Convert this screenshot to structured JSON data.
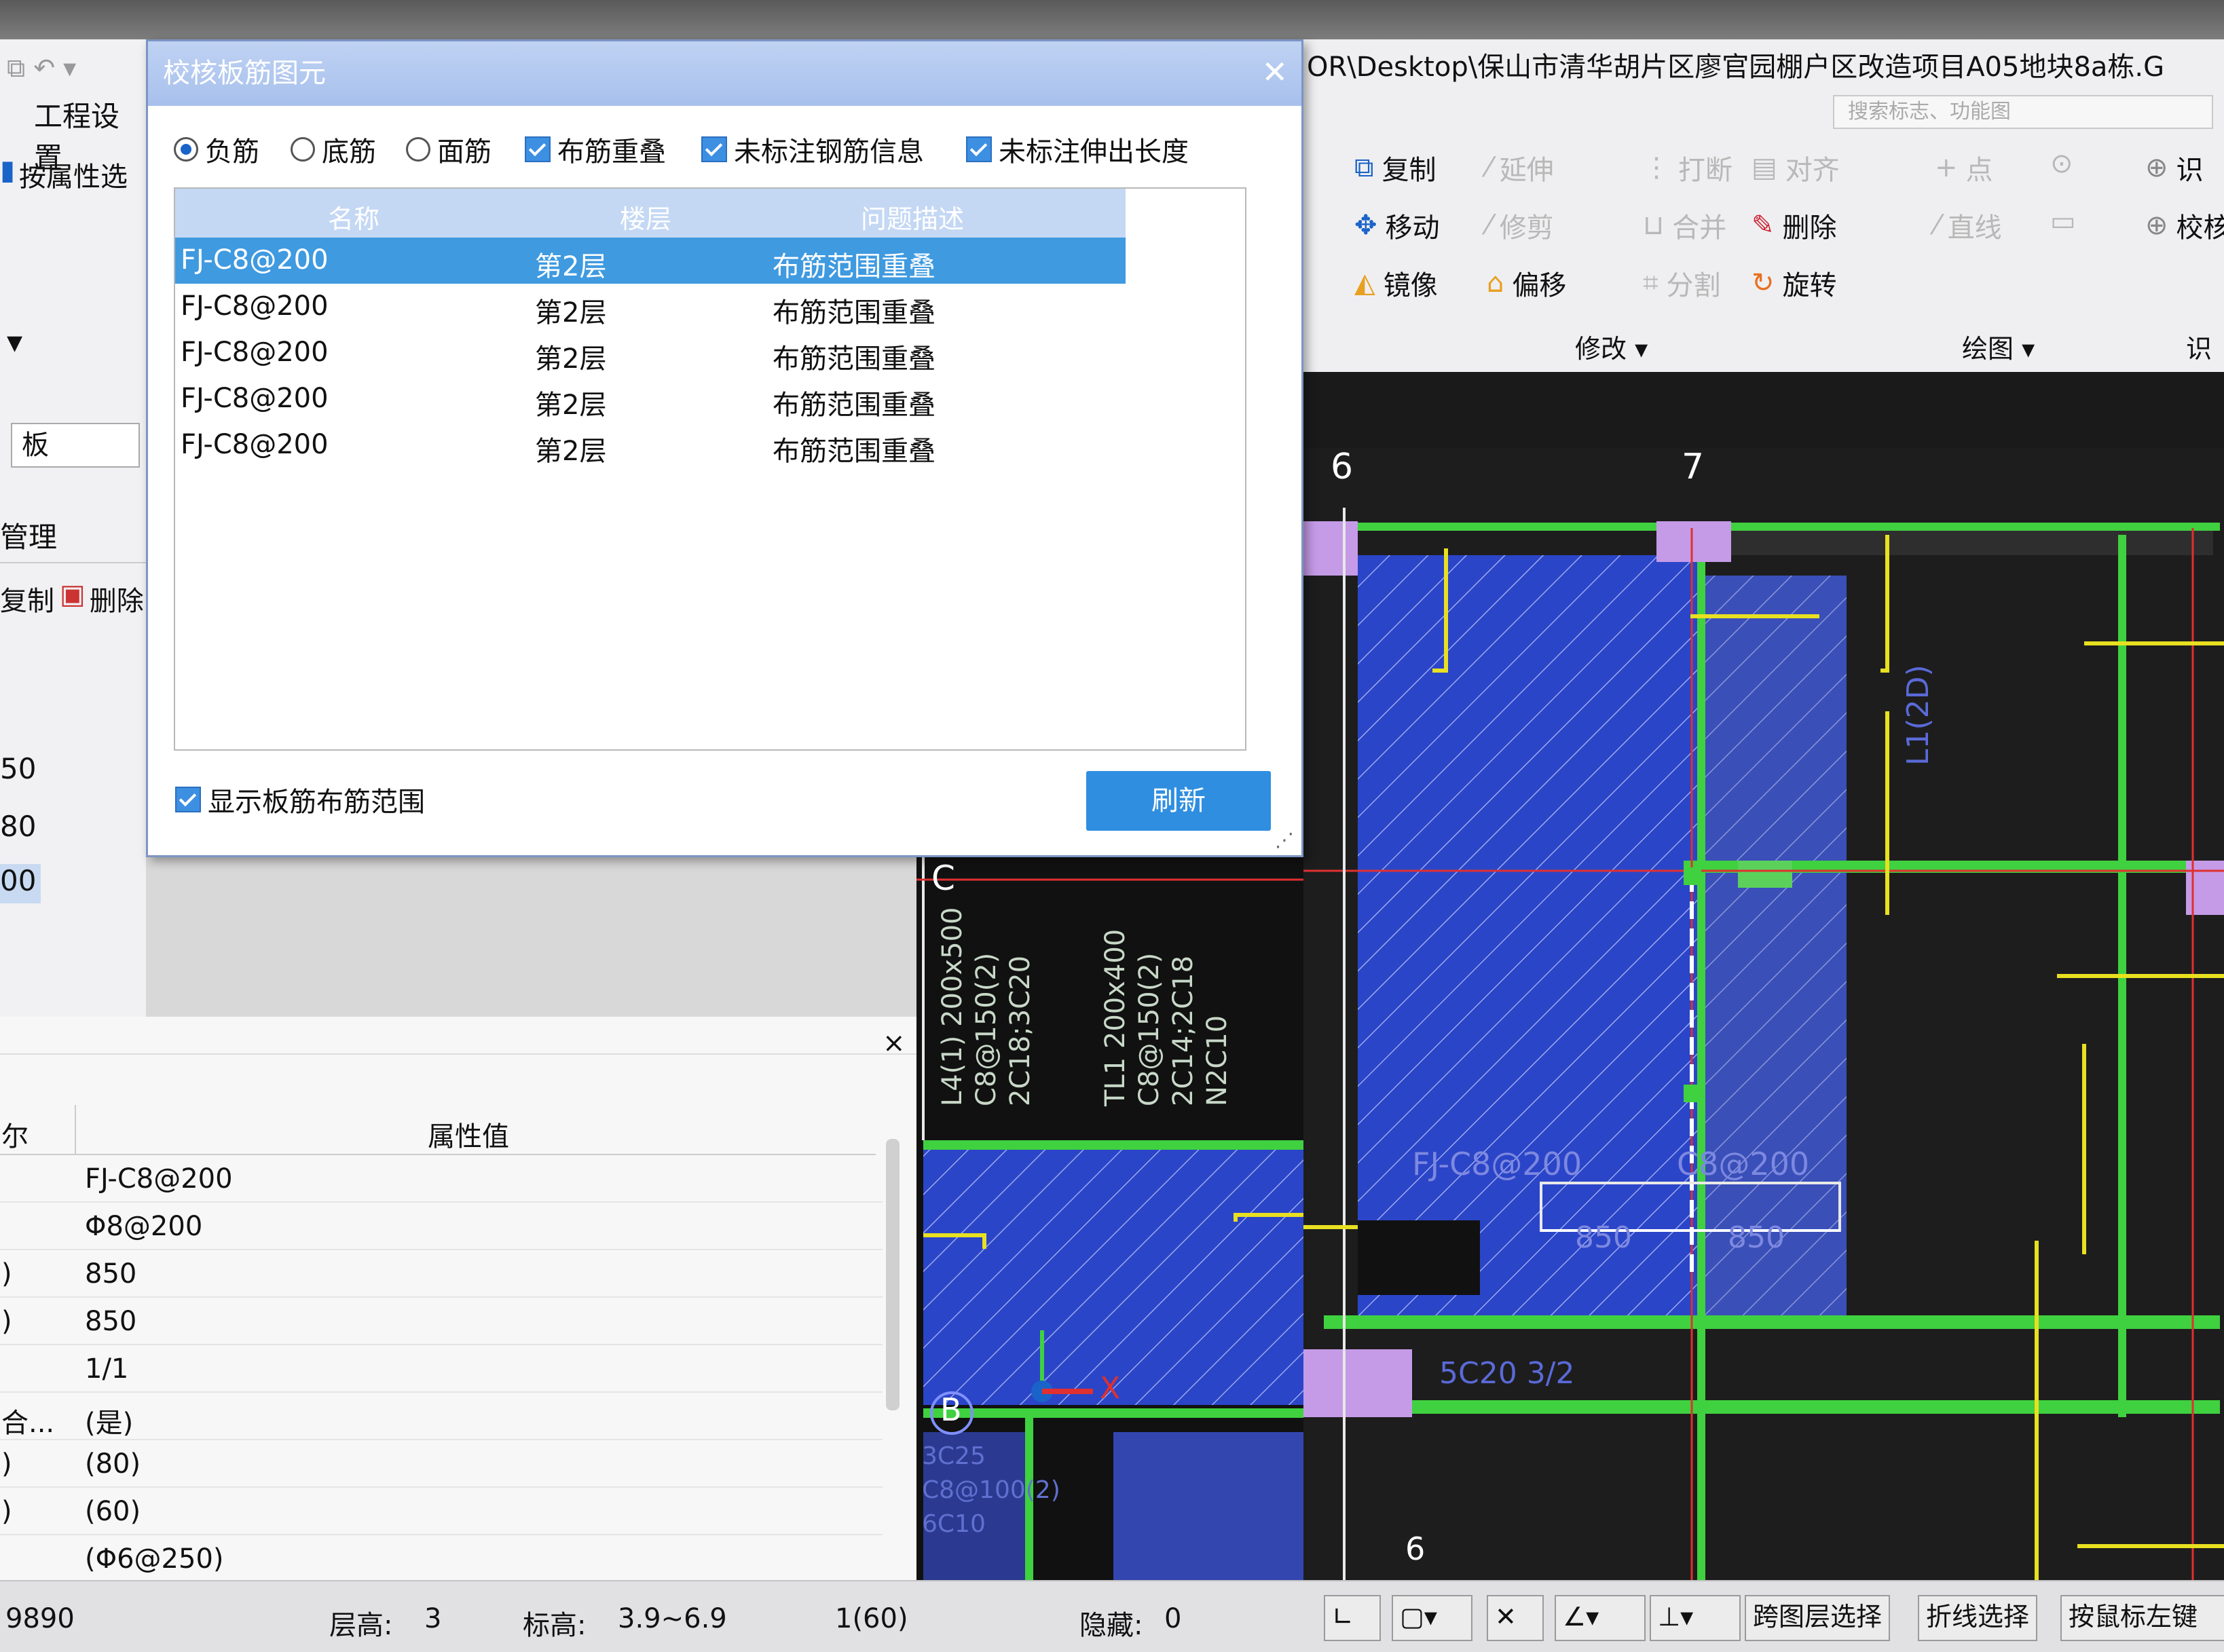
{
  "window": {
    "path": "OR\\Desktop\\保山市清华胡片区廖官园棚户区改造项目A05地块8a栋.G",
    "search_placeholder": "搜索标志、功能图"
  },
  "left_panel": {
    "menu": "工程设置",
    "filter_btn": "按属性选",
    "type_value": "板",
    "manage_tab": "管理",
    "copy_btn": "复制",
    "delete_btn": "删除",
    "values": [
      "50",
      "80",
      "00"
    ]
  },
  "ribbon": {
    "modify": {
      "copy": "复制",
      "extend": "延伸",
      "break": "打断",
      "align": "对齐",
      "move": "移动",
      "trim": "修剪",
      "merge": "合并",
      "delete": "删除",
      "mirror": "镜像",
      "offset": "偏移",
      "split": "分割",
      "rotate": "旋转",
      "label": "修改"
    },
    "draw": {
      "point": "点",
      "line": "直线",
      "label": "绘图"
    },
    "identify": {
      "item1": "识",
      "item2": "校核",
      "label": "识"
    }
  },
  "dialog": {
    "title": "校核板筋图元",
    "options": {
      "neg": "负筋",
      "bottom": "底筋",
      "top": "面筋"
    },
    "checks": {
      "overlap": "布筋重叠",
      "unlabeled_info": "未标注钢筋信息",
      "unlabeled_len": "未标注伸出长度"
    },
    "columns": {
      "name": "名称",
      "floor": "楼层",
      "issue": "问题描述"
    },
    "rows": [
      {
        "name": "FJ-C8@200",
        "floor": "第2层",
        "issue": "布筋范围重叠"
      },
      {
        "name": "FJ-C8@200",
        "floor": "第2层",
        "issue": "布筋范围重叠"
      },
      {
        "name": "FJ-C8@200",
        "floor": "第2层",
        "issue": "布筋范围重叠"
      },
      {
        "name": "FJ-C8@200",
        "floor": "第2层",
        "issue": "布筋范围重叠"
      },
      {
        "name": "FJ-C8@200",
        "floor": "第2层",
        "issue": "布筋范围重叠"
      }
    ],
    "show_range": "显示板筋布筋范围",
    "refresh": "刷新"
  },
  "properties": {
    "header_name": "尔",
    "header_value": "属性值",
    "rows": [
      {
        "k": "",
        "v": "FJ-C8@200"
      },
      {
        "k": "",
        "v": "Φ8@200"
      },
      {
        "k": ")",
        "v": "850"
      },
      {
        "k": ")",
        "v": "850"
      },
      {
        "k": "",
        "v": "1/1"
      },
      {
        "k": "合...",
        "v": "(是)"
      },
      {
        "k": ")",
        "v": "(80)"
      },
      {
        "k": ")",
        "v": "(60)"
      },
      {
        "k": "",
        "v": "(Φ6@250)"
      }
    ]
  },
  "canvas": {
    "axis_6": "6",
    "axis_7": "7",
    "axis_c": "C",
    "axis_b": "B",
    "axis_6b": "6",
    "note1": "L4(1) 200x500",
    "note2": "C8@150(2)",
    "note3": "2C18;3C20",
    "note4": "TL1 200x400",
    "note5": "C8@150(2)",
    "note6": "2C14;2C18",
    "note7": "N2C10",
    "rebar_label": "FJ-C8@200",
    "rebar_label2": "C8@200",
    "dim1": "850",
    "dim2": "850",
    "beam_label": "L1(2D)",
    "bot1": "3C25",
    "bot2": "C8@100(2)",
    "bot3": "6C10",
    "mid_label": "5C20 3/2",
    "x_axis": "X"
  },
  "status": {
    "coord": "9890",
    "floor_h_label": "层高:",
    "floor_h": "3",
    "elev_label": "标高:",
    "elev": "3.9~6.9",
    "count": "1(60)",
    "hidden_label": "隐藏:",
    "hidden": "0",
    "btn_cross_layer": "跨图层选择",
    "btn_polyline": "折线选择",
    "btn_left": "按鼠标左键"
  },
  "colors": {
    "accent": "#2f8ee0",
    "slab": "#2b45c8",
    "beam": "#3fd13f",
    "rebar": "#e8e020"
  }
}
